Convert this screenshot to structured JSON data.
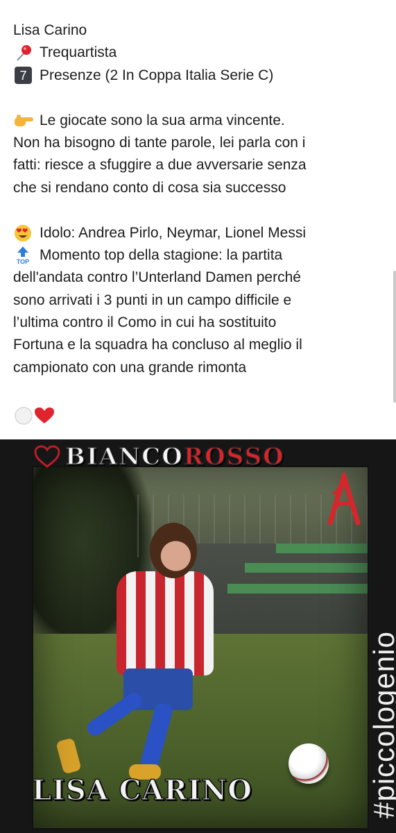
{
  "post": {
    "name": "Lisa Carino",
    "role_icon": "round-pushpin-icon",
    "role": "Trequartista",
    "appearances_icon": "keycap-7-icon",
    "appearances": "Presenze (2 In Coppa Italia Serie C)",
    "description_icon": "backhand-index-pointing-right-icon",
    "description_lines": [
      "Le giocate sono la sua arma vincente.",
      "Non ha bisogno di tante parole, lei parla con i",
      "fatti: riesce a sfuggire a due avversarie senza",
      "che si rendano conto di cosa sia successo"
    ],
    "idol_icon": "heart-eyes-face-icon",
    "idol": "Idolo: Andrea Pirlo, Neymar, Lionel Messi",
    "top_icon": "top-arrow-icon",
    "top_lines": [
      "Momento top della stagione: la partita",
      "dell'andata contro l’Unterland Damen perché",
      "sono arrivati i 3 punti in un campo difficile e",
      "l’ultima contro il Como in cui ha sostituito",
      "Fortuna e la squadra ha concluso al meglio il",
      "campionato con una grande rimonta"
    ],
    "footer_icons": [
      "white-circle-icon",
      "red-heart-icon"
    ]
  },
  "photo": {
    "brand_part1": "BIANCO",
    "brand_part2": "ROSSO",
    "player_name": "LISA CARINO",
    "hashtag": "#piccologenio",
    "colors": {
      "red": "#d7252b",
      "white": "#f4f4f4",
      "frame": "#161616"
    }
  }
}
